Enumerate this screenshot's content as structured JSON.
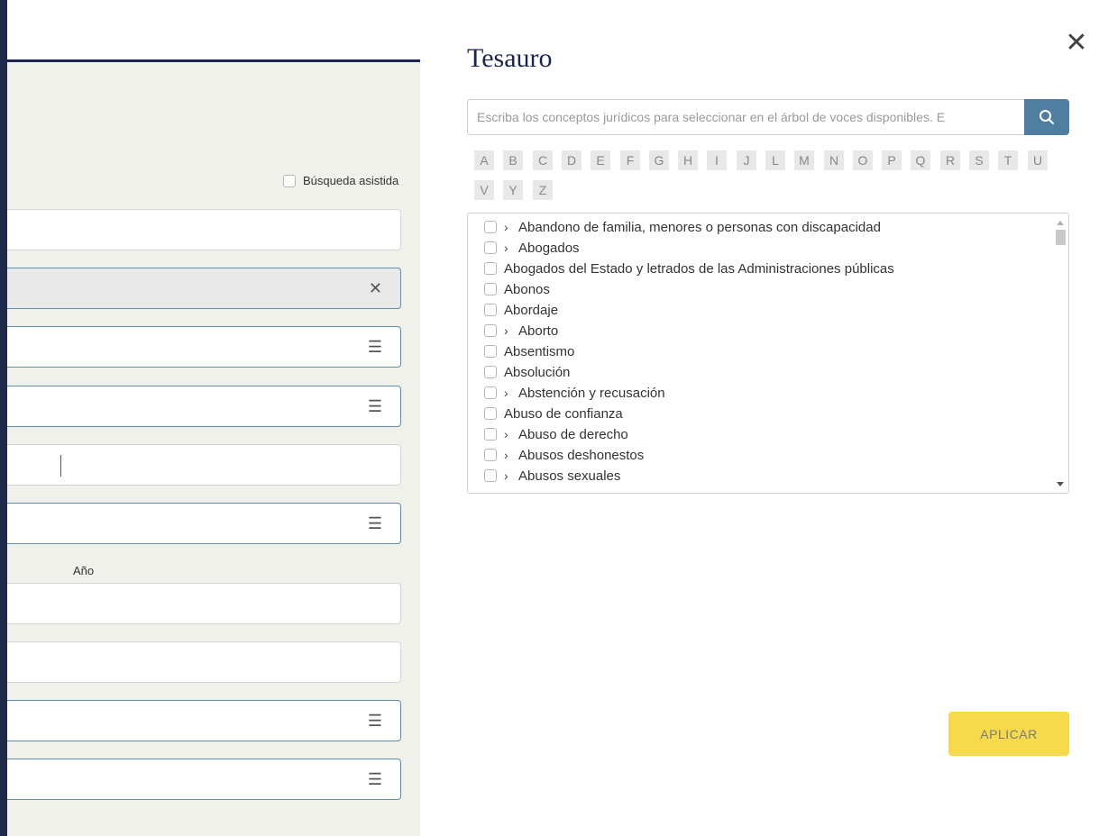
{
  "left_form": {
    "assisted_search_label": "Búsqueda asistida",
    "year_label": "Año",
    "fields": [
      {
        "type": "text"
      },
      {
        "type": "clearable",
        "suffix": "✕"
      },
      {
        "type": "menu",
        "suffix": "☰"
      },
      {
        "type": "menu",
        "suffix": "☰"
      },
      {
        "type": "text-active"
      },
      {
        "type": "menu",
        "suffix": "☰"
      },
      {
        "type": "text"
      },
      {
        "type": "text"
      },
      {
        "type": "menu",
        "suffix": "☰"
      },
      {
        "type": "menu",
        "suffix": "☰"
      }
    ]
  },
  "panel": {
    "title": "Tesauro",
    "close_glyph": "✕",
    "search": {
      "placeholder": "Escriba los conceptos jurídicos para seleccionar en el árbol de voces disponibles. E",
      "value": ""
    },
    "letters": [
      "A",
      "B",
      "C",
      "D",
      "E",
      "F",
      "G",
      "H",
      "I",
      "J",
      "L",
      "M",
      "N",
      "O",
      "P",
      "Q",
      "R",
      "S",
      "T",
      "U",
      "V",
      "Y",
      "Z"
    ],
    "tree_items": [
      {
        "label": "Abandono de familia, menores o personas con discapacidad",
        "expandable": true
      },
      {
        "label": "Abogados",
        "expandable": true
      },
      {
        "label": "Abogados del Estado y letrados de las Administraciones públicas",
        "expandable": false
      },
      {
        "label": "Abonos",
        "expandable": false
      },
      {
        "label": "Abordaje",
        "expandable": false
      },
      {
        "label": "Aborto",
        "expandable": true
      },
      {
        "label": "Absentismo",
        "expandable": false
      },
      {
        "label": "Absolución",
        "expandable": false
      },
      {
        "label": "Abstención y recusación",
        "expandable": true
      },
      {
        "label": "Abuso de confianza",
        "expandable": false
      },
      {
        "label": "Abuso de derecho",
        "expandable": true
      },
      {
        "label": "Abusos deshonestos",
        "expandable": true
      },
      {
        "label": "Abusos sexuales",
        "expandable": true
      }
    ],
    "apply_label": "APLICAR"
  },
  "colors": {
    "navy": "#1b2550",
    "search_button": "#4f7ea1",
    "apply_button": "#f7d94c",
    "form_background": "#f1f1ec"
  }
}
